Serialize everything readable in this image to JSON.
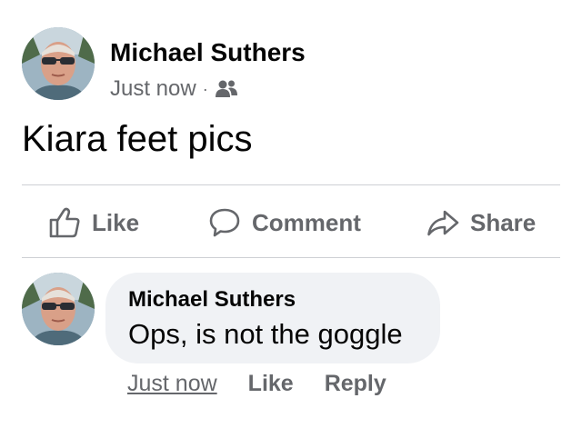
{
  "post": {
    "author": "Michael Suthers",
    "timestamp": "Just now",
    "separator": "·",
    "audience_icon": "friends-icon",
    "text": "Kiara feet pics"
  },
  "actions": {
    "like": "Like",
    "comment": "Comment",
    "share": "Share"
  },
  "comment": {
    "author": "Michael Suthers",
    "text": "Ops, is not the goggle",
    "timestamp": "Just now",
    "like": "Like",
    "reply": "Reply"
  },
  "colors": {
    "secondary_text": "#65676b",
    "primary_text": "#050505",
    "bubble": "#f0f2f5",
    "divider": "#ced0d4"
  }
}
